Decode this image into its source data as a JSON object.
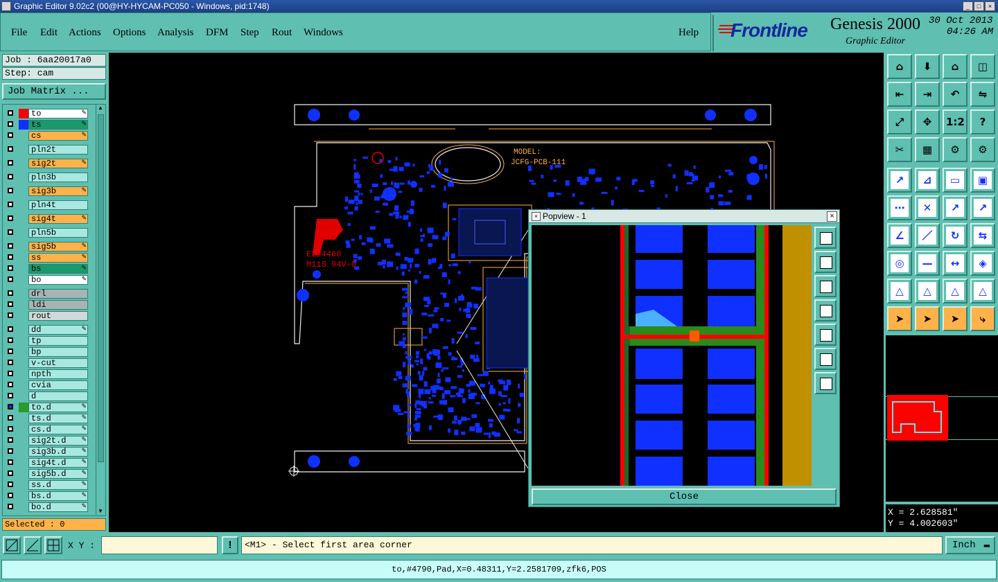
{
  "window": {
    "title": "Graphic Editor 9.02c2 (00@HY-HYCAM-PC050 - Windows, pid:1748)"
  },
  "menu": {
    "items": [
      "File",
      "Edit",
      "Actions",
      "Options",
      "Analysis",
      "DFM",
      "Step",
      "Rout",
      "Windows"
    ],
    "help": "Help"
  },
  "brand": {
    "logo": "Frontline",
    "product": "Genesis 2000",
    "subtitle": "Graphic Editor",
    "date": "30 Oct 2013",
    "time": "04:26 AM"
  },
  "job": {
    "job_label": "Job : 6aa20017a0",
    "step_label": "Step: cam",
    "matrix_button": "Job Matrix ..."
  },
  "layers": [
    {
      "name": "to",
      "swatch": "#ff0000",
      "bg": "#ffffff",
      "edit": true
    },
    {
      "name": "ts",
      "swatch": "#1030ff",
      "bg": "#1a9a6a",
      "edit": true
    },
    {
      "name": "cs",
      "swatch": "",
      "bg": "#ffb24a",
      "edit": true
    },
    {
      "name": "pln2t",
      "swatch": "",
      "bg": "#a8e8e0",
      "edit": false,
      "gap": true
    },
    {
      "name": "sig2t",
      "swatch": "",
      "bg": "#ffb24a",
      "edit": true,
      "gap": true
    },
    {
      "name": "pln3b",
      "swatch": "",
      "bg": "#a8e8e0",
      "edit": false,
      "gap": true
    },
    {
      "name": "sig3b",
      "swatch": "",
      "bg": "#ffb24a",
      "edit": true,
      "gap": true
    },
    {
      "name": "pln4t",
      "swatch": "",
      "bg": "#a8e8e0",
      "edit": false,
      "gap": true
    },
    {
      "name": "sig4t",
      "swatch": "",
      "bg": "#ffb24a",
      "edit": true,
      "gap": true
    },
    {
      "name": "pln5b",
      "swatch": "",
      "bg": "#a8e8e0",
      "edit": false,
      "gap": true
    },
    {
      "name": "sig5b",
      "swatch": "",
      "bg": "#ffb24a",
      "edit": true,
      "gap": true
    },
    {
      "name": "ss",
      "swatch": "",
      "bg": "#ffb24a",
      "edit": true
    },
    {
      "name": "bs",
      "swatch": "",
      "bg": "#1a9a6a",
      "edit": true
    },
    {
      "name": "bo",
      "swatch": "",
      "bg": "#ffffff",
      "edit": true
    },
    {
      "name": "drl",
      "swatch": "",
      "bg": "#a8b4b4",
      "edit": false,
      "gap": true
    },
    {
      "name": "ldi",
      "swatch": "",
      "bg": "#a8b4b4",
      "edit": false
    },
    {
      "name": "rout",
      "swatch": "",
      "bg": "#d0d8d8",
      "edit": false
    },
    {
      "name": "dd",
      "swatch": "",
      "bg": "#a8e8e0",
      "edit": true,
      "gap": true
    },
    {
      "name": "tp",
      "swatch": "",
      "bg": "#a8e8e0",
      "edit": false
    },
    {
      "name": "bp",
      "swatch": "",
      "bg": "#a8e8e0",
      "edit": false
    },
    {
      "name": "v-cut",
      "swatch": "",
      "bg": "#a8e8e0",
      "edit": false
    },
    {
      "name": "npth",
      "swatch": "",
      "bg": "#a8e8e0",
      "edit": false
    },
    {
      "name": "cvia",
      "swatch": "",
      "bg": "#a8e8e0",
      "edit": false
    },
    {
      "name": "d",
      "swatch": "",
      "bg": "#a8e8e0",
      "edit": false
    },
    {
      "name": "to.d",
      "swatch": "#2a9a2a",
      "bg": "#a8e8e0",
      "edit": true,
      "active": true
    },
    {
      "name": "ts.d",
      "swatch": "",
      "bg": "#a8e8e0",
      "edit": true
    },
    {
      "name": "cs.d",
      "swatch": "",
      "bg": "#a8e8e0",
      "edit": true
    },
    {
      "name": "sig2t.d",
      "swatch": "",
      "bg": "#a8e8e0",
      "edit": true
    },
    {
      "name": "sig3b.d",
      "swatch": "",
      "bg": "#a8e8e0",
      "edit": true
    },
    {
      "name": "sig4t.d",
      "swatch": "",
      "bg": "#a8e8e0",
      "edit": true
    },
    {
      "name": "sig5b.d",
      "swatch": "",
      "bg": "#a8e8e0",
      "edit": true
    },
    {
      "name": "ss.d",
      "swatch": "",
      "bg": "#a8e8e0",
      "edit": true
    },
    {
      "name": "bs.d",
      "swatch": "",
      "bg": "#a8e8e0",
      "edit": true
    },
    {
      "name": "bo.d",
      "swatch": "",
      "bg": "#a8e8e0",
      "edit": true
    }
  ],
  "selected": "Selected : 0",
  "board": {
    "model_label": "MODEL:",
    "model_value": "JCFG-PCB-111",
    "ul_code": "E204460",
    "ul_rating": "M11S 94V-0"
  },
  "popview": {
    "title": "Popview - 1",
    "close_label": "Close"
  },
  "coords": {
    "x": "X = 2.628581\"",
    "y": "Y = 4.002603\""
  },
  "command": {
    "xy_label": "X Y :",
    "xy_value": "",
    "prompt": "<M1> - Select first area corner",
    "units": "Inch"
  },
  "status": {
    "text": "to,#4790,Pad,X=0.48311,Y=2.2581709,zfk6,POS"
  },
  "colors": {
    "teal": "#5fbfb0",
    "canvas": "#000000",
    "pad": "#1030ff",
    "outline": "#ffb24a",
    "red": "#ff0000"
  }
}
